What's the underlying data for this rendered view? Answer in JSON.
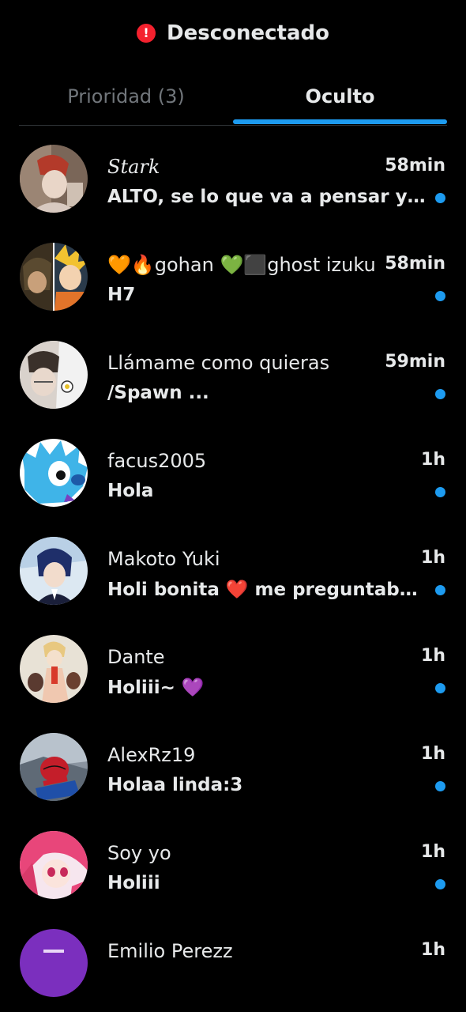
{
  "status": {
    "icon": "error-icon",
    "label": "Desconectado",
    "color": "#f4212e"
  },
  "tabs": [
    {
      "label": "Prioridad (3)",
      "active": false
    },
    {
      "label": "Oculto",
      "active": true
    }
  ],
  "accent": "#1d9bf0",
  "conversations": [
    {
      "name": "Stark",
      "time": "58min",
      "message": "ALTO, se lo que va a pensar y no, ...",
      "unread": true
    },
    {
      "name": "🧡🔥gohan 💚⬛ghost izuku",
      "time": "58min",
      "message": "H7",
      "unread": true
    },
    {
      "name": "Llámame como quieras",
      "time": "59min",
      "message": "/Spawn ...",
      "unread": true
    },
    {
      "name": "facus2005",
      "time": "1h",
      "message": "Hola",
      "unread": true
    },
    {
      "name": "Makoto Yuki",
      "time": "1h",
      "message": "Holi bonita ❤️ me preguntaba si q...",
      "unread": true
    },
    {
      "name": "Dante",
      "time": "1h",
      "message": "Holiii~ 💜",
      "unread": true
    },
    {
      "name": "AlexRz19",
      "time": "1h",
      "message": "Holaa linda:3",
      "unread": true
    },
    {
      "name": "Soy yo",
      "time": "1h",
      "message": "Holiii",
      "unread": true
    },
    {
      "name": "Emilio Perezz",
      "time": "1h",
      "message": "",
      "unread": false
    }
  ]
}
